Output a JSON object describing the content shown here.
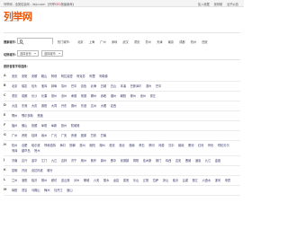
{
  "topbar": {
    "left_prefix": "列举网 - 全类信息网 - lieju.com",
    "left_bracket": "【列举",
    "left_red": "CEO",
    "left_suffix": "按赢使命】",
    "right_links": [
      "加入收藏",
      "找帮助",
      "证书公告"
    ]
  },
  "logo": {
    "text": "列举网",
    "sub": "www.lieju.com"
  },
  "search": {
    "label": "搜索城市：",
    "placeholder": "",
    "hot_cities": [
      "热门城市：",
      "北京",
      "上海",
      "广州",
      "深圳",
      "武汉",
      "重庆",
      "苏州",
      "天津",
      "南京",
      "成都",
      "杭州",
      "西安"
    ]
  },
  "selectors": {
    "label": "切换城市：",
    "province": "选择省份",
    "city": "选择城市",
    "enter_label": "进入"
  },
  "section_title": "按拼音首字母选择：",
  "letter_rows": [
    {
      "letter": "A",
      "cities": [
        "安庆",
        "安阳",
        "安顺",
        "鞍山",
        "阿坝",
        "阿拉善盟",
        "阿克苏",
        "阿里",
        "阿勒泰"
      ]
    },
    {
      "letter": "B",
      "cities": [
        "北京",
        "保定",
        "包头",
        "宝鸡",
        "蚌埠",
        "亳州",
        "巴中",
        "百色",
        "北海",
        "白城",
        "白山",
        "本溪",
        "巴彦淖尔",
        "滨州",
        "巴中"
      ]
    },
    {
      "letter": "C",
      "cities": [
        "重庆",
        "成都",
        "长沙",
        "长春",
        "常州",
        "沧州",
        "承德",
        "常德",
        "郴州",
        "赤峰",
        "潮州",
        "朝阳",
        "滁州",
        "池州",
        "崇左"
      ]
    },
    {
      "letter": "D",
      "cities": [
        "大连",
        "东莞",
        "大庆",
        "德阳",
        "大同",
        "丹东",
        "德州",
        "东营",
        "达州",
        "大理",
        "定西"
      ]
    },
    {
      "letter": "E",
      "cities": [
        "鄂州",
        "鄂尔多斯",
        "恩施"
      ]
    },
    {
      "letter": "F",
      "cities": [
        "福州",
        "佛山",
        "抚顺",
        "阜阳",
        "阜新",
        "抚州",
        "防城港"
      ]
    },
    {
      "letter": "G",
      "cities": [
        "广州",
        "贵阳",
        "桂林",
        "赣州",
        "广元",
        "广安",
        "贵港",
        "固原",
        "甘孜",
        "甘南"
      ]
    },
    {
      "letter": "H",
      "cities": [
        "杭州",
        "合肥",
        "哈尔滨",
        "呼和浩特",
        "海口",
        "邯郸",
        "惠州",
        "衡阳",
        "湖州",
        "淮安",
        "淮北",
        "淮南",
        "黄石",
        "黄冈",
        "河源",
        "汉中",
        "鹤岗",
        "黑河",
        "红河",
        "怀化",
        "呼伦贝尔",
        "菏泽",
        "葫芦岛",
        "贺州"
      ]
    },
    {
      "letter": "J",
      "cities": [
        "济南",
        "嘉兴",
        "金华",
        "江门",
        "九江",
        "吉林",
        "济宁",
        "荆州",
        "焦作",
        "锦州",
        "晋中",
        "景德镇",
        "揭阳",
        "佳木斯",
        "荆门",
        "鸡西",
        "吉安",
        "晋城",
        "酒泉",
        "九江",
        "金昌"
      ]
    },
    {
      "letter": "K",
      "cities": [
        "昆明",
        "开封",
        "克拉玛依",
        "喀什"
      ]
    },
    {
      "letter": "L",
      "cities": [
        "兰州",
        "洛阳",
        "临沂",
        "柳州",
        "廊坊",
        "连云港",
        "泸州",
        "聊城",
        "六安",
        "丽水",
        "龙岩",
        "娄底",
        "乐山",
        "辽阳",
        "拉萨",
        "凉山",
        "临汾",
        "吕梁",
        "丽江",
        "六盘水",
        "漯河",
        "来宾"
      ]
    },
    {
      "letter": "M",
      "cities": [
        "绵阳",
        "茂名",
        "马鞍山",
        "梅州",
        "牡丹江",
        "眉山"
      ]
    }
  ]
}
